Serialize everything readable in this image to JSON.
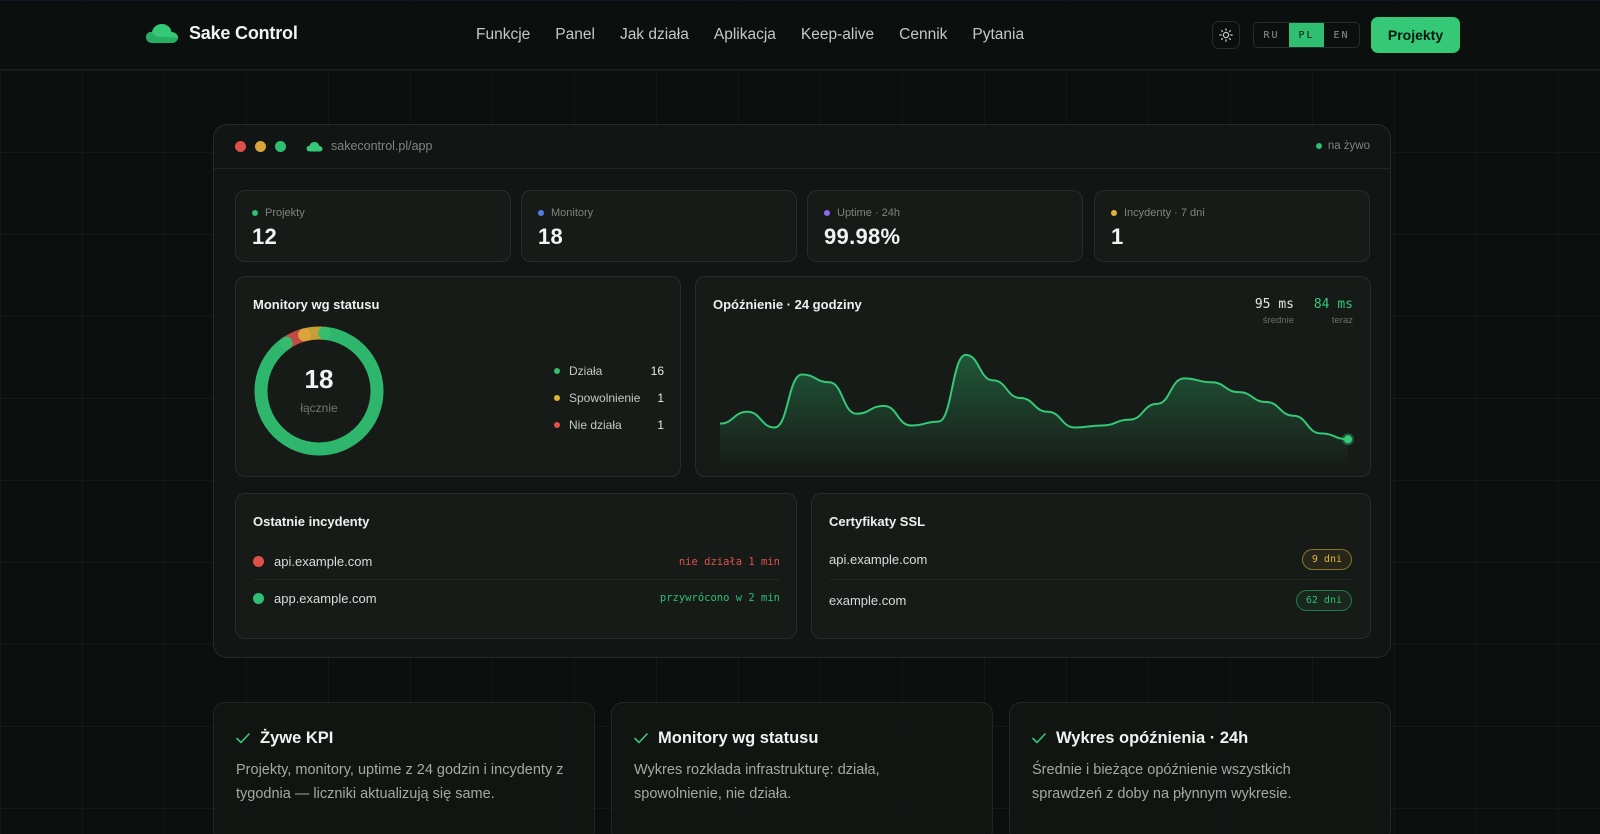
{
  "brand": {
    "name": "Sake Control",
    "accent": "#34c877"
  },
  "nav": {
    "links": [
      "Funkcje",
      "Panel",
      "Jak działa",
      "Aplikacja",
      "Keep-alive",
      "Cennik",
      "Pytania"
    ],
    "theme_icon": "sun-icon",
    "languages": [
      "RU",
      "PL",
      "EN"
    ],
    "active_language": "PL",
    "cta_label": "Projekty"
  },
  "window": {
    "url": "sakecontrol.pl/app",
    "live_label": "na żywo",
    "dots": [
      "#e0504a",
      "#d9a53a",
      "#2fbf71"
    ]
  },
  "kpis": [
    {
      "label": "Projekty",
      "value": "12",
      "color": "#2fbf71"
    },
    {
      "label": "Monitory",
      "value": "18",
      "color": "#4f7fe6"
    },
    {
      "label": "Uptime · 24h",
      "value": "99.98%",
      "color": "#8a6cf0"
    },
    {
      "label": "Incydenty · 7 dni",
      "value": "1",
      "color": "#e0b43a"
    }
  ],
  "status": {
    "title": "Monitory wg statusu",
    "total": "18",
    "total_label": "łącznie",
    "items": [
      {
        "label": "Działa",
        "value": "16",
        "count": 16,
        "color": "#2fbf71"
      },
      {
        "label": "Spowolnienie",
        "value": "1",
        "count": 1,
        "color": "#e0b43a"
      },
      {
        "label": "Nie działa",
        "value": "1",
        "count": 1,
        "color": "#e0504a"
      }
    ]
  },
  "latency": {
    "title": "Opóźnienie · 24 godziny",
    "avg_value": "95 ms",
    "avg_label": "średnie",
    "now_value": "84 ms",
    "now_label": "teraz"
  },
  "chart_data": {
    "type": "area",
    "title": "Opóźnienie · 24 godziny",
    "x": [
      0,
      1,
      2,
      3,
      4,
      5,
      6,
      7,
      8,
      9,
      10,
      11,
      12,
      13,
      14,
      15,
      16,
      17,
      18,
      19,
      20,
      21,
      22,
      23
    ],
    "values": [
      100,
      112,
      96,
      150,
      142,
      110,
      118,
      98,
      102,
      170,
      144,
      126,
      112,
      96,
      98,
      104,
      120,
      146,
      142,
      132,
      122,
      108,
      90,
      84
    ],
    "color": "#34c877"
  },
  "incidents": {
    "title": "Ostatnie incydenty",
    "items": [
      {
        "host": "api.example.com",
        "status": "nie działa 1 min",
        "color": "#e0504a"
      },
      {
        "host": "app.example.com",
        "status": "przywrócono w 2 min",
        "color": "#2fbf71"
      }
    ]
  },
  "ssl": {
    "title": "Certyfikaty SSL",
    "items": [
      {
        "host": "api.example.com",
        "days": "9 dni",
        "color": "#e0b43a"
      },
      {
        "host": "example.com",
        "days": "62 dni",
        "color": "#2fbf71"
      }
    ]
  },
  "features": [
    {
      "title": "Żywe KPI",
      "desc": "Projekty, monitory, uptime z 24 godzin i incydenty z tygodnia — liczniki aktualizują się same."
    },
    {
      "title": "Monitory wg statusu",
      "desc": "Wykres rozkłada infrastrukturę: działa, spowolnienie, nie działa."
    },
    {
      "title": "Wykres opóźnienia · 24h",
      "desc": "Średnie i bieżące opóźnienie wszystkich sprawdzeń z doby na płynnym wykresie."
    }
  ]
}
